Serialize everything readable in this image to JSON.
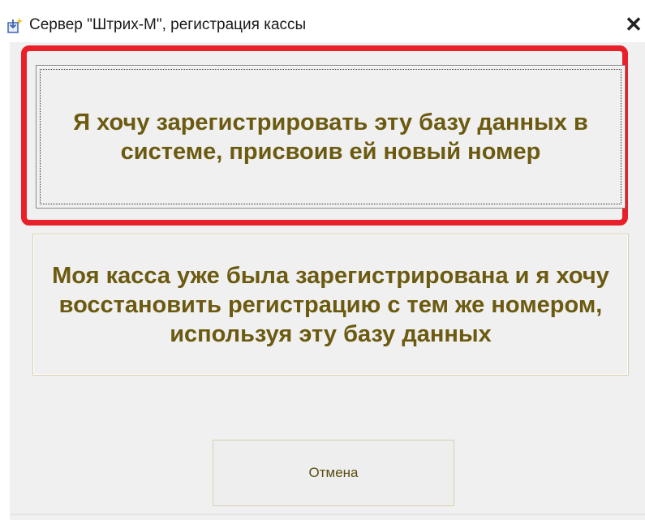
{
  "window": {
    "title": "Сервер \"Штрих-М\", регистрация кассы",
    "close_glyph": "✕",
    "icon": "install-package-icon"
  },
  "options": {
    "register_label": "Я хочу зарегистрировать эту базу данных в системе, присвоив ей новый номер",
    "restore_label": "Моя касса уже была зарегистрирована и я хочу восстановить регистрацию с тем же номером, используя эту базу данных"
  },
  "footer": {
    "cancel_label": "Отмена"
  },
  "colors": {
    "highlight_border": "#e8202a",
    "button_text": "#6b5a10",
    "dialog_background": "#f0f0f0"
  }
}
